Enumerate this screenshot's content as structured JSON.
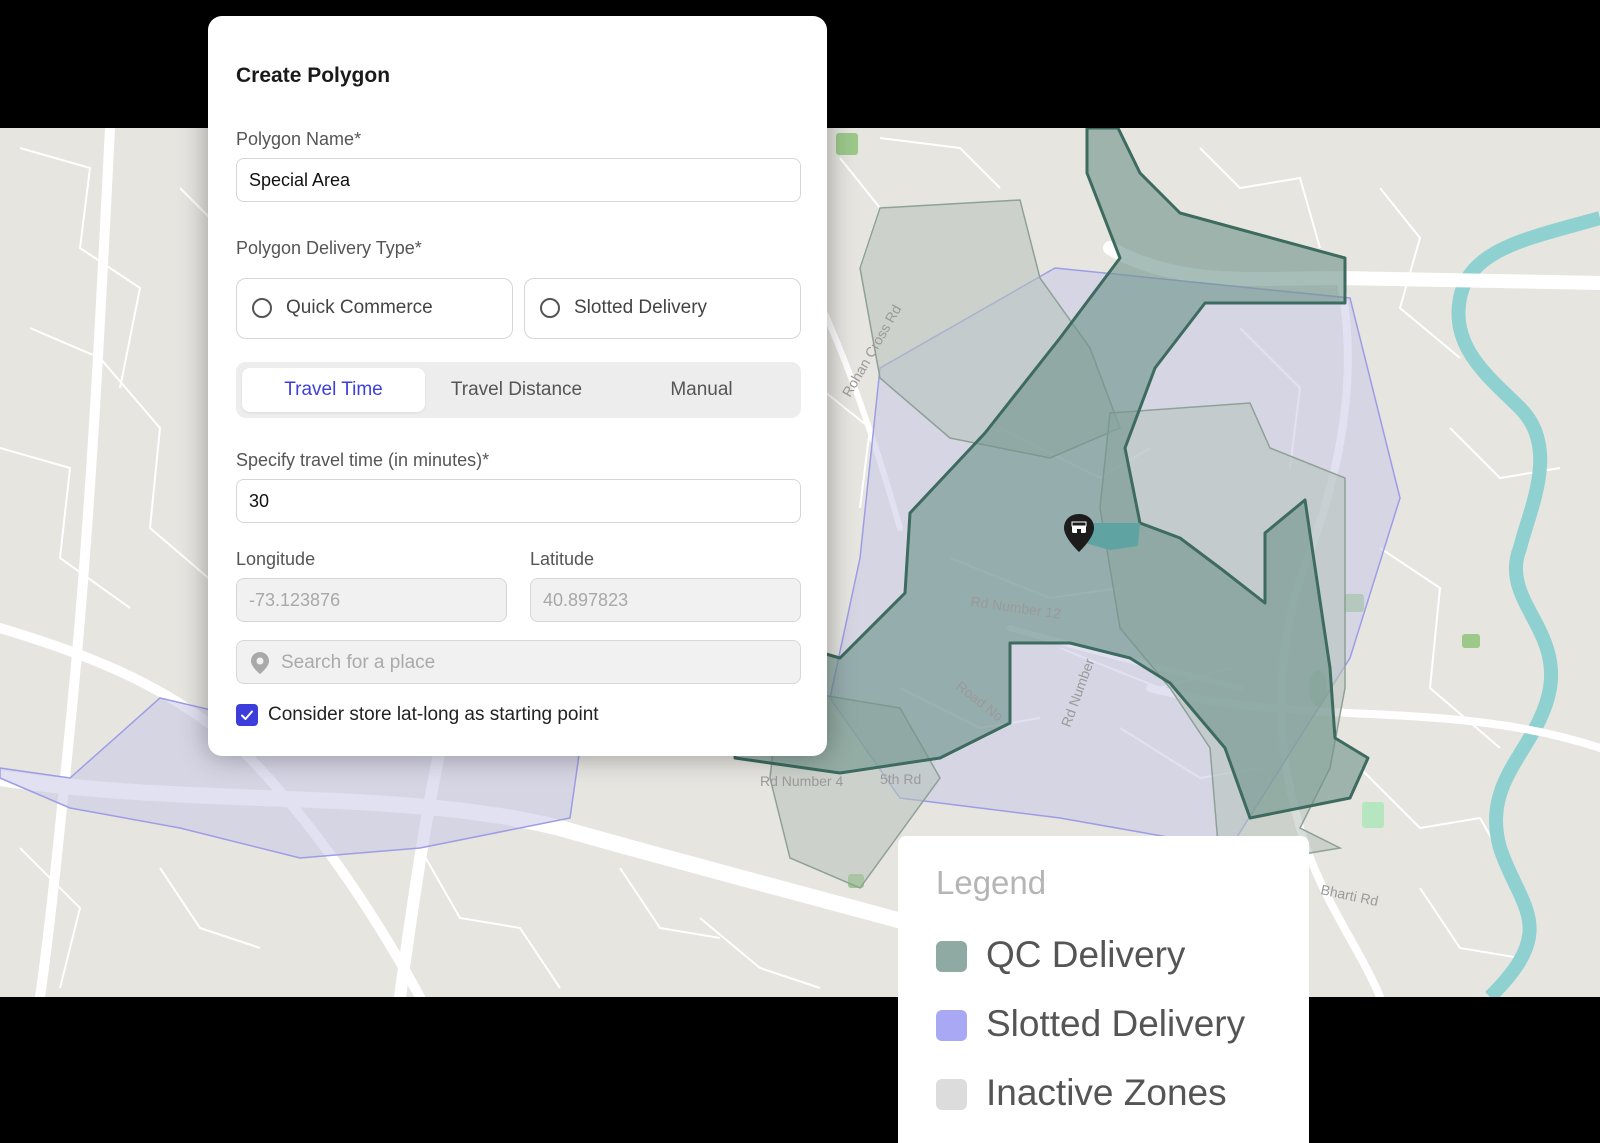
{
  "panel": {
    "title": "Create Polygon",
    "name_label": "Polygon Name*",
    "name_value": "Special Area",
    "delivery_type_label": "Polygon Delivery Type*",
    "delivery_options": [
      "Quick Commerce",
      "Slotted Delivery"
    ],
    "method_tabs": [
      "Travel Time",
      "Travel Distance",
      "Manual"
    ],
    "active_tab": "Travel Time",
    "travel_time_label": "Specify travel time (in minutes)*",
    "travel_time_value": "30",
    "longitude_label": "Longitude",
    "longitude_placeholder": "-73.123876",
    "latitude_label": "Latitude",
    "latitude_placeholder": "40.897823",
    "search_placeholder": "Search for a place",
    "checkbox_label": "Consider store lat-long as starting point",
    "checkbox_checked": true
  },
  "legend": {
    "title": "Legend",
    "items": [
      {
        "label": "QC Delivery",
        "color": "#8fa9a3"
      },
      {
        "label": "Slotted Delivery",
        "color": "#a8a8f4"
      },
      {
        "label": "Inactive Zones",
        "color": "#dcdcdc"
      }
    ]
  },
  "map": {
    "road_labels": [
      "Rd Number 12",
      "Rd Number 4",
      "5th Rd",
      "Road No",
      "Rd Number",
      "Bharti Rd",
      "Rohan Cross Rd"
    ],
    "colors": {
      "land": "#e6e5e0",
      "road": "#ffffff",
      "river": "#8fd1d0",
      "park": "#9cc88a",
      "qc_fill": "#6f958c",
      "qc_stroke": "#3d6b5f",
      "slotted_fill": "#c9c9e8",
      "slotted_stroke": "#9d9de6",
      "inactive_fill": "#b7c2ba",
      "store_pin": "#1c1c1c"
    }
  },
  "colors": {
    "accent": "#3d3ddb"
  }
}
